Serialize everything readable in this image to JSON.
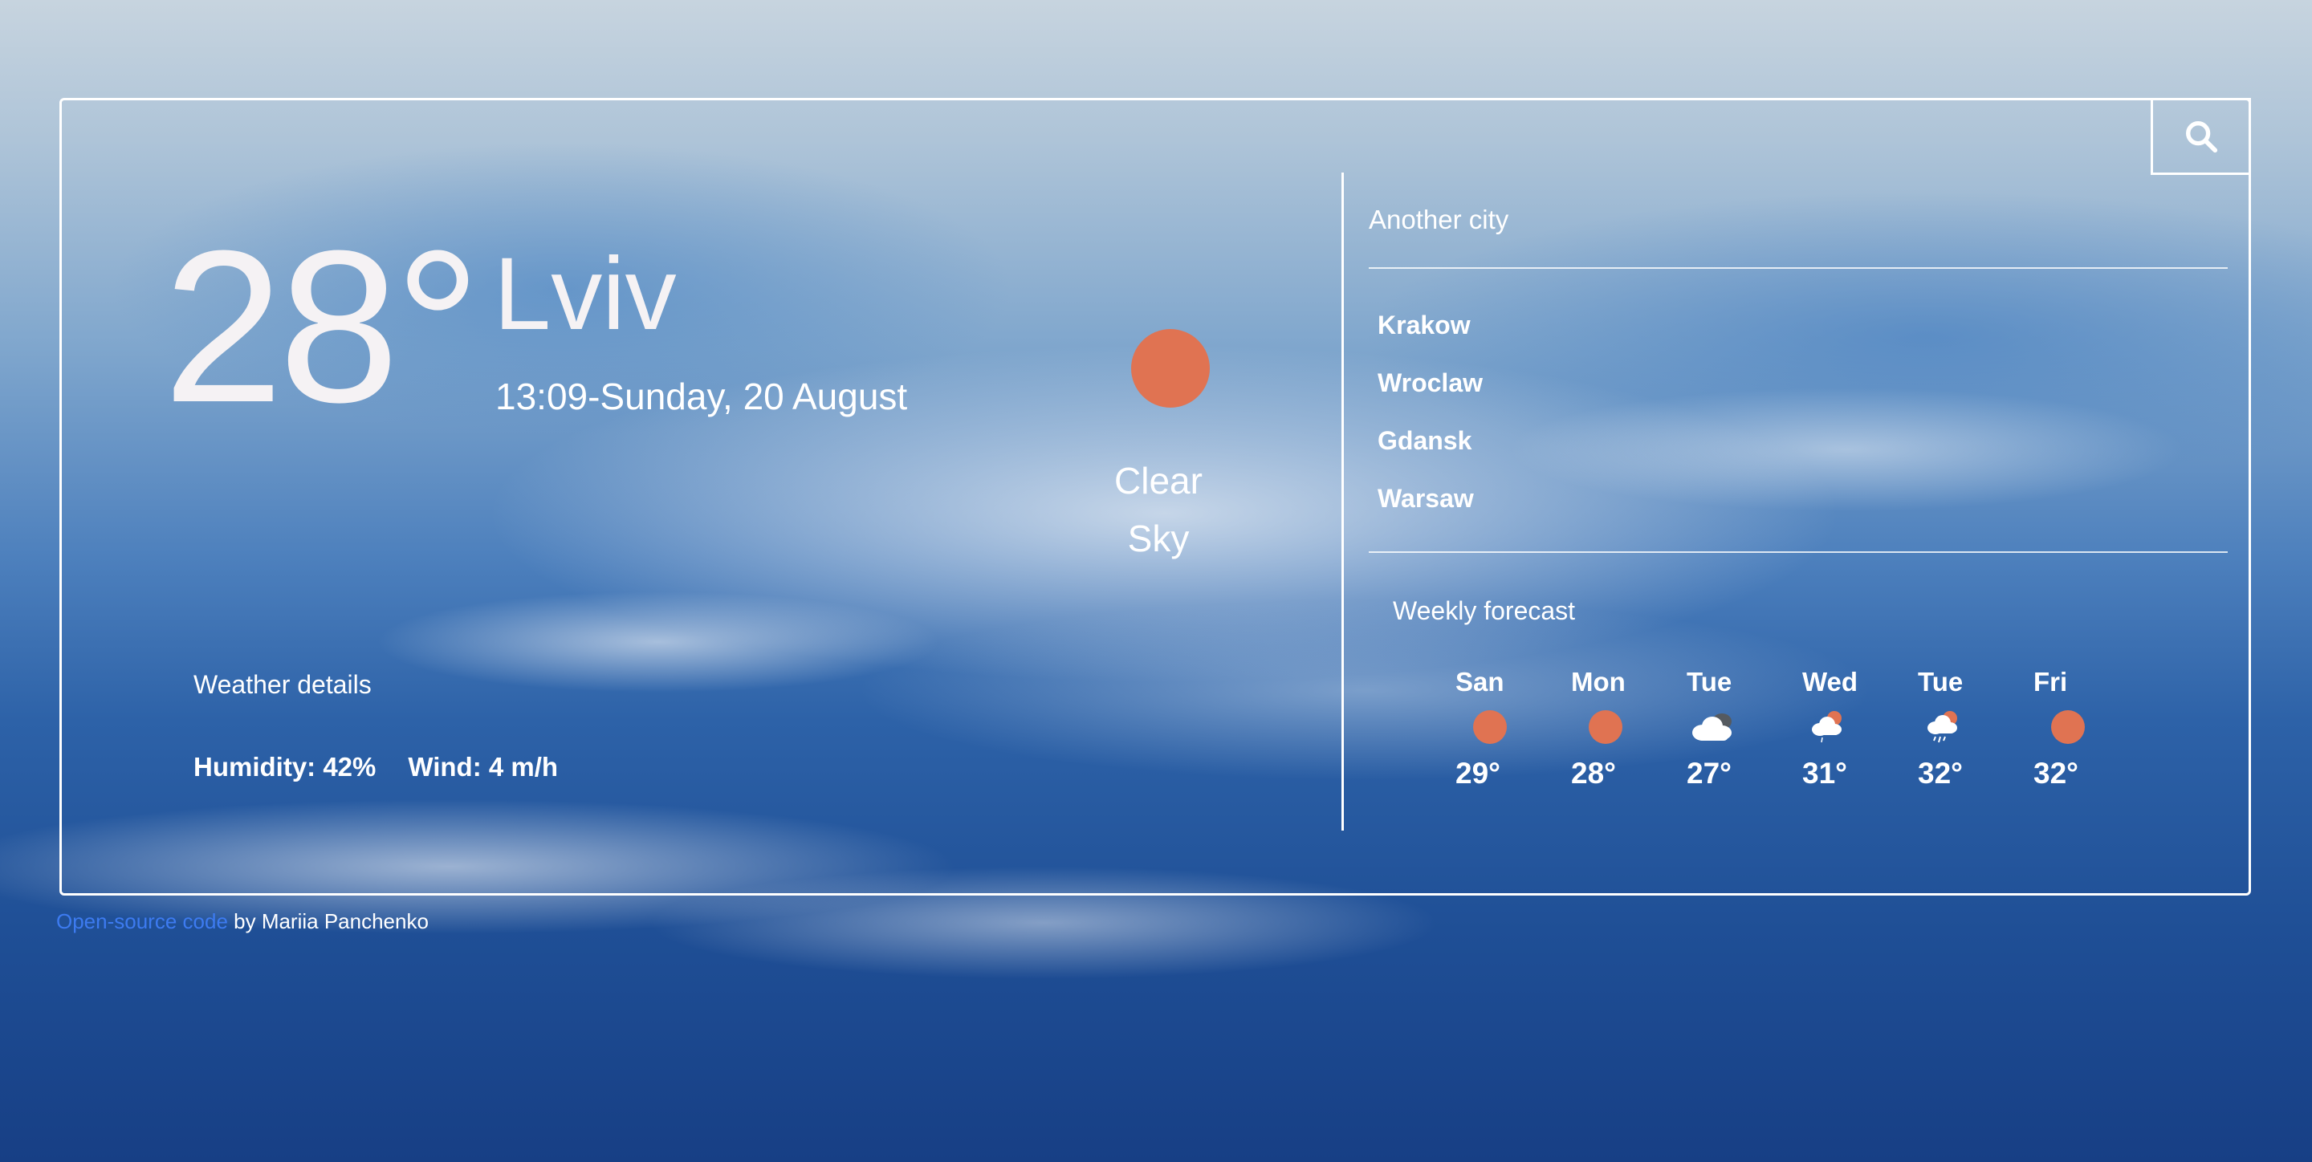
{
  "current": {
    "temperature": "28°",
    "city": "Lviv",
    "datetime": "13:09-Sunday, 20 August",
    "condition_line1": "Clear",
    "condition_line2": "Sky",
    "condition_icon": "sun-icon"
  },
  "details": {
    "title": "Weather details",
    "humidity": "Humidity: 42%",
    "wind": "Wind: 4 m/h"
  },
  "search": {
    "placeholder": "Another city",
    "button_icon": "search-icon"
  },
  "cities": [
    "Krakow",
    "Wroclaw",
    "Gdansk",
    "Warsaw"
  ],
  "weekly": {
    "title": "Weekly forecast",
    "days": [
      {
        "name": "San",
        "temp": "29°",
        "icon": "sun-icon"
      },
      {
        "name": "Mon",
        "temp": "28°",
        "icon": "sun-icon"
      },
      {
        "name": "Tue",
        "temp": "27°",
        "icon": "cloud-icon"
      },
      {
        "name": "Wed",
        "temp": "31°",
        "icon": "sun-cloud-icon"
      },
      {
        "name": "Tue",
        "temp": "32°",
        "icon": "rain-icon"
      },
      {
        "name": "Fri",
        "temp": "32°",
        "icon": "sun-icon"
      }
    ]
  },
  "footer": {
    "link_text": "Open-source code",
    "author_text": " by Mariia Panchenko"
  },
  "colors": {
    "accent_sun": "#e07352",
    "link": "#3d7bf0",
    "text": "#ffffff"
  }
}
